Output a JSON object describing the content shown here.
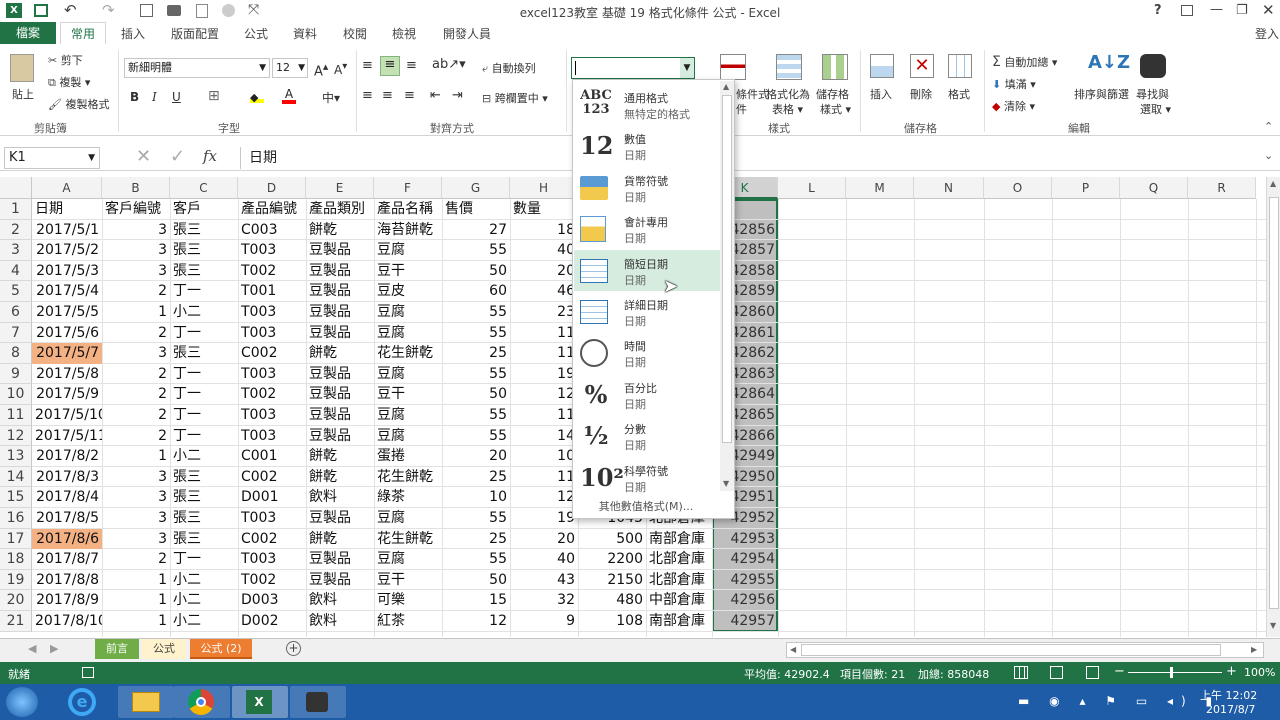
{
  "window": {
    "title": "excel123教室 基礎 19 格式化條件 公式 - Excel",
    "help": "?",
    "user": "登入"
  },
  "tabs": [
    "檔案",
    "常用",
    "插入",
    "版面配置",
    "公式",
    "資料",
    "校閱",
    "檢視",
    "開發人員"
  ],
  "ribbon": {
    "clipboard": {
      "paste": "貼上",
      "cut": "剪下",
      "copy": "複製",
      "format_painter": "複製格式",
      "label": "剪貼簿"
    },
    "font": {
      "name": "新細明體",
      "size": "12",
      "bold": "B",
      "italic": "I",
      "underline": "U",
      "label": "字型"
    },
    "alignment": {
      "wrap": "自動換列",
      "merge": "跨欄置中",
      "label": "對齊方式"
    },
    "number": {
      "format_value": ""
    },
    "styles": {
      "cond": "條件式",
      "cond2": "件",
      "fmt_table": "格式化為",
      "fmt_table2": "表格",
      "cell_styles": "儲存格",
      "cell_styles2": "樣式",
      "label": "樣式"
    },
    "cells": {
      "insert": "插入",
      "delete": "刪除",
      "format": "格式",
      "label": "儲存格"
    },
    "editing": {
      "autosum": "自動加總",
      "fill": "填滿",
      "clear": "清除",
      "sort": "排序與篩選",
      "find": "尋找與",
      "find2": "選取",
      "label": "編輯"
    }
  },
  "formula_bar": {
    "name_box": "K1",
    "fx": "fx",
    "content": "日期"
  },
  "columns": [
    "A",
    "B",
    "C",
    "D",
    "E",
    "F",
    "G",
    "H",
    "I",
    "J",
    "K",
    "L",
    "M",
    "N",
    "O",
    "P",
    "Q",
    "R"
  ],
  "rows": [
    {
      "n": "1",
      "a": "日期",
      "b": "客戶編號",
      "c": "客戶",
      "d": "產品編號",
      "e": "產品類別",
      "f": "產品名稱",
      "g": "售價",
      "h": "數量",
      "i": "",
      "j": "",
      "k": "期"
    },
    {
      "n": "2",
      "a": "2017/5/1",
      "b": "3",
      "c": "張三",
      "d": "C003",
      "e": "餅乾",
      "f": "海苔餅乾",
      "g": "27",
      "h": "18",
      "i": "",
      "j": "",
      "k": "42856"
    },
    {
      "n": "3",
      "a": "2017/5/2",
      "b": "3",
      "c": "張三",
      "d": "T003",
      "e": "豆製品",
      "f": "豆腐",
      "g": "55",
      "h": "40",
      "i": "",
      "j": "",
      "k": "42857"
    },
    {
      "n": "4",
      "a": "2017/5/3",
      "b": "3",
      "c": "張三",
      "d": "T002",
      "e": "豆製品",
      "f": "豆干",
      "g": "50",
      "h": "20",
      "i": "",
      "j": "",
      "k": "42858"
    },
    {
      "n": "5",
      "a": "2017/5/4",
      "b": "2",
      "c": "丁一",
      "d": "T001",
      "e": "豆製品",
      "f": "豆皮",
      "g": "60",
      "h": "46",
      "i": "",
      "j": "",
      "k": "42859"
    },
    {
      "n": "6",
      "a": "2017/5/5",
      "b": "1",
      "c": "小二",
      "d": "T003",
      "e": "豆製品",
      "f": "豆腐",
      "g": "55",
      "h": "23",
      "i": "",
      "j": "",
      "k": "42860"
    },
    {
      "n": "7",
      "a": "2017/5/6",
      "b": "2",
      "c": "丁一",
      "d": "T003",
      "e": "豆製品",
      "f": "豆腐",
      "g": "55",
      "h": "11",
      "i": "",
      "j": "",
      "k": "42861"
    },
    {
      "n": "8",
      "a": "2017/5/7",
      "b": "3",
      "c": "張三",
      "d": "C002",
      "e": "餅乾",
      "f": "花生餅乾",
      "g": "25",
      "h": "11",
      "i": "",
      "j": "",
      "k": "42862"
    },
    {
      "n": "9",
      "a": "2017/5/8",
      "b": "2",
      "c": "丁一",
      "d": "T003",
      "e": "豆製品",
      "f": "豆腐",
      "g": "55",
      "h": "19",
      "i": "",
      "j": "",
      "k": "42863"
    },
    {
      "n": "10",
      "a": "2017/5/9",
      "b": "2",
      "c": "丁一",
      "d": "T002",
      "e": "豆製品",
      "f": "豆干",
      "g": "50",
      "h": "12",
      "i": "",
      "j": "",
      "k": "42864"
    },
    {
      "n": "11",
      "a": "2017/5/10",
      "b": "2",
      "c": "丁一",
      "d": "T003",
      "e": "豆製品",
      "f": "豆腐",
      "g": "55",
      "h": "11",
      "i": "",
      "j": "",
      "k": "42865"
    },
    {
      "n": "12",
      "a": "2017/5/11",
      "b": "2",
      "c": "丁一",
      "d": "T003",
      "e": "豆製品",
      "f": "豆腐",
      "g": "55",
      "h": "14",
      "i": "",
      "j": "",
      "k": "42866"
    },
    {
      "n": "13",
      "a": "2017/8/2",
      "b": "1",
      "c": "小二",
      "d": "C001",
      "e": "餅乾",
      "f": "蛋捲",
      "g": "20",
      "h": "10",
      "i": "",
      "j": "",
      "k": "42949"
    },
    {
      "n": "14",
      "a": "2017/8/3",
      "b": "3",
      "c": "張三",
      "d": "C002",
      "e": "餅乾",
      "f": "花生餅乾",
      "g": "25",
      "h": "11",
      "i": "",
      "j": "",
      "k": "42950"
    },
    {
      "n": "15",
      "a": "2017/8/4",
      "b": "3",
      "c": "張三",
      "d": "D001",
      "e": "飲料",
      "f": "綠茶",
      "g": "10",
      "h": "12",
      "i": "",
      "j": "",
      "k": "42951"
    },
    {
      "n": "16",
      "a": "2017/8/5",
      "b": "3",
      "c": "張三",
      "d": "T003",
      "e": "豆製品",
      "f": "豆腐",
      "g": "55",
      "h": "19",
      "i": "1045",
      "j": "北部倉庫",
      "k": "42952"
    },
    {
      "n": "17",
      "a": "2017/8/6",
      "b": "3",
      "c": "張三",
      "d": "C002",
      "e": "餅乾",
      "f": "花生餅乾",
      "g": "25",
      "h": "20",
      "i": "500",
      "j": "南部倉庫",
      "k": "42953"
    },
    {
      "n": "18",
      "a": "2017/8/7",
      "b": "2",
      "c": "丁一",
      "d": "T003",
      "e": "豆製品",
      "f": "豆腐",
      "g": "55",
      "h": "40",
      "i": "2200",
      "j": "北部倉庫",
      "k": "42954"
    },
    {
      "n": "19",
      "a": "2017/8/8",
      "b": "1",
      "c": "小二",
      "d": "T002",
      "e": "豆製品",
      "f": "豆干",
      "g": "50",
      "h": "43",
      "i": "2150",
      "j": "北部倉庫",
      "k": "42955"
    },
    {
      "n": "20",
      "a": "2017/8/9",
      "b": "1",
      "c": "小二",
      "d": "D003",
      "e": "飲料",
      "f": "可樂",
      "g": "15",
      "h": "32",
      "i": "480",
      "j": "中部倉庫",
      "k": "42956"
    },
    {
      "n": "21",
      "a": "2017/8/10",
      "b": "1",
      "c": "小二",
      "d": "D002",
      "e": "飲料",
      "f": "紅茶",
      "g": "12",
      "h": "9",
      "i": "108",
      "j": "南部倉庫",
      "k": "42957"
    }
  ],
  "highlighted_rows": [
    "8",
    "17"
  ],
  "number_format_menu": {
    "items": [
      {
        "icon": "ABC 123",
        "name": "通用格式",
        "sub": "無特定的格式"
      },
      {
        "icon": "12",
        "name": "數值",
        "sub": "日期"
      },
      {
        "icon": "currency-icon",
        "name": "貨幣符號",
        "sub": "日期"
      },
      {
        "icon": "accounting-icon",
        "name": "會計專用",
        "sub": "日期"
      },
      {
        "icon": "calendar-icon",
        "name": "簡短日期",
        "sub": "日期"
      },
      {
        "icon": "calendar-icon",
        "name": "詳細日期",
        "sub": "日期"
      },
      {
        "icon": "clock-icon",
        "name": "時間",
        "sub": "日期"
      },
      {
        "icon": "%",
        "name": "百分比",
        "sub": "日期"
      },
      {
        "icon": "½",
        "name": "分數",
        "sub": "日期"
      },
      {
        "icon": "10²",
        "name": "科學符號",
        "sub": "日期"
      }
    ],
    "more": "其他數值格式(M)..."
  },
  "sheets": [
    "前言",
    "公式",
    "公式 (2)"
  ],
  "status": {
    "ready": "就緒",
    "average": "平均值: 42902.4",
    "count": "項目個數: 21",
    "sum": "加總: 858048",
    "zoom": "100%"
  },
  "taskbar": {
    "time": "上午 12:02",
    "date": "2017/8/7"
  },
  "colors": {
    "excel_green": "#217346",
    "highlight": "#f4b183",
    "selected_col": "#bfbfbf",
    "menu_hover": "#d5ecdf",
    "taskbar": "#1e5ca8"
  }
}
